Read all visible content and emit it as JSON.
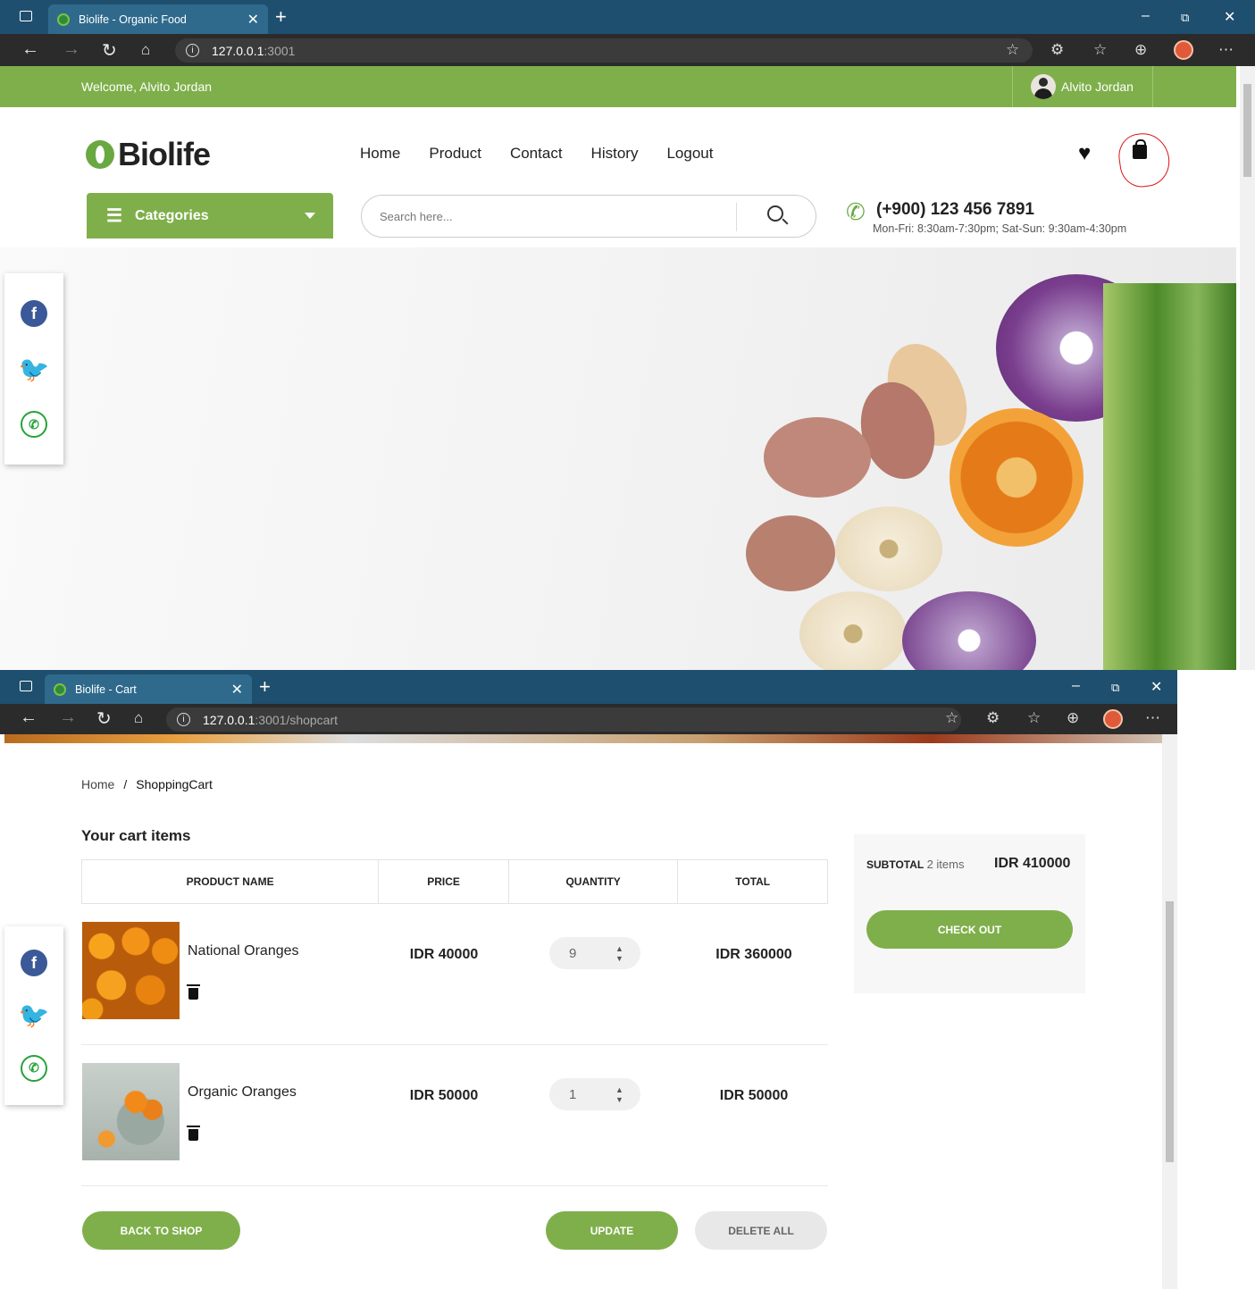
{
  "window1": {
    "tab_title": "Biolife - Organic Food",
    "url_host": "127.0.0.1",
    "url_rest": ":3001",
    "welcome": "Welcome, Alvito Jordan",
    "username": "Alvito Jordan",
    "logo": "Biolife",
    "menu": [
      "Home",
      "Product",
      "Contact",
      "History",
      "Logout"
    ],
    "categories_label": "Categories",
    "search_placeholder": "Search here...",
    "phone": "(+900) 123 456 7891",
    "hours": "Mon-Fri: 8:30am-7:30pm; Sat-Sun: 9:30am-4:30pm"
  },
  "window2": {
    "tab_title": "Biolife - Cart",
    "url_host": "127.0.0.1",
    "url_rest": ":3001/shopcart",
    "breadcrumb": {
      "home": "Home",
      "sep": "/",
      "current": "ShoppingCart"
    },
    "heading": "Your cart items",
    "columns": [
      "PRODUCT NAME",
      "PRICE",
      "QUANTITY",
      "TOTAL"
    ],
    "items": [
      {
        "name": "National Oranges",
        "price": "IDR 40000",
        "qty": "9",
        "total": "IDR 360000"
      },
      {
        "name": "Organic Oranges",
        "price": "IDR 50000",
        "qty": "1",
        "total": "IDR 50000"
      }
    ],
    "buttons": {
      "back": "BACK TO SHOP",
      "update": "UPDATE",
      "delete_all": "DELETE ALL",
      "checkout": "CHECK OUT"
    },
    "summary": {
      "label": "SUBTOTAL",
      "count": "2 items",
      "amount": "IDR 410000"
    }
  },
  "colors": {
    "brand_green": "#7faf4b",
    "tabbar": "#1f4f6e",
    "annotation_red": "#d11"
  }
}
